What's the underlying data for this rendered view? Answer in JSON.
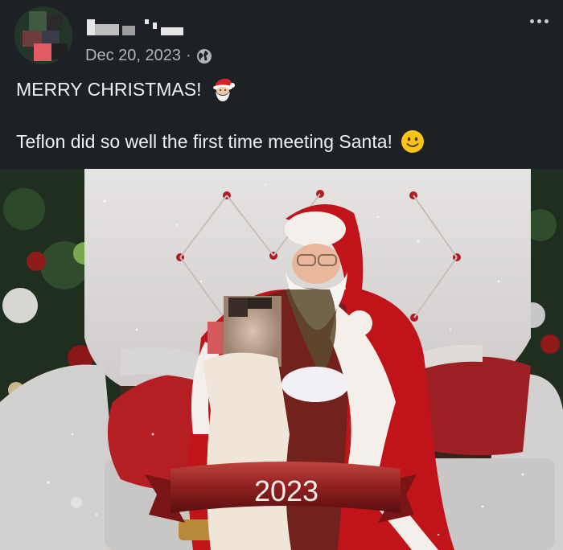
{
  "post": {
    "date": "Dec 20, 2023",
    "separator": "·",
    "privacy_icon": "globe-icon",
    "more_icon": "more-options-icon",
    "line1": "MERRY CHRISTMAS!",
    "line1_emoji": "santa-face-emoji",
    "line2": "Teflon did so well the first time meeting Santa!",
    "line2_emoji": "smiling-face-emoji"
  },
  "photo": {
    "banner_text": "2023"
  },
  "colors": {
    "background": "#1d2125",
    "text": "#eef0f3",
    "meta": "#b0b3b8",
    "banner": "#a52a2a",
    "santa_red": "#c0141a"
  }
}
